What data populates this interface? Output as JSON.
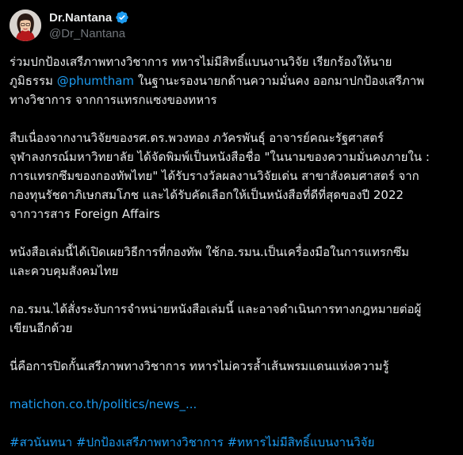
{
  "author": {
    "name": "Dr.Nantana",
    "handle": "@Dr_Nantana"
  },
  "colors": {
    "background": "#000000",
    "text": "#e7e9ea",
    "secondary": "#71767b",
    "link": "#1d9bf0"
  },
  "icons": {
    "verified": "verified-badge-icon"
  },
  "tweet": {
    "p1": {
      "l1": "ร่วมปกป้องเสรีภาพทางวิชาการ ทหารไม่มีสิทธิ์แบนงานวิจัย  เรียกร้องให้นาย",
      "l2_pre": "ภูมิธรรม ",
      "mention": "@phumtham",
      "l2_post": " ในฐานะรองนายกด้านความมั่นคง ออกมาปกป้องเสรีภาพ",
      "l3": "ทางวิชาการ จากการแทรกแซงของทหาร"
    },
    "p2": {
      "l1": "สืบเนื่องจากงานวิจัยของรศ.ดร.พวงทอง ภวัครพันธุ์ อาจารย์คณะรัฐศาสตร์",
      "l2": "จุฬาลงกรณ์มหาวิทยาลัย ได้จัดพิมพ์เป็นหนังสือชื่อ \"ในนามของความมั่นคงภายใน :",
      "l3": "การแทรกซึมของกองทัพไทย\" ได้รับรางวัลผลงานวิจัยเด่น สาขาสังคมศาสตร์ จาก",
      "l4": "กองทุนรัชดาภิเษกสมโภช และได้รับคัดเลือกให้เป็นหนังสือที่ดีที่สุดของปี 2022",
      "l5": "จากวารสาร Foreign Affairs"
    },
    "p3": {
      "l1": "หนังสือเล่มนี้ได้เปิดเผยวิธีการที่กองทัพ ใช้กอ.รมน.เป็นเครื่องมือในการแทรกซึม",
      "l2": "และควบคุมสังคมไทย"
    },
    "p4": {
      "l1": "กอ.รมน.ได้สั่งระงับการจำหน่ายหนังสือเล่มนี้ และอาจดำเนินการทางกฎหมายต่อผู้",
      "l2": "เขียนอีกด้วย"
    },
    "p5": {
      "l1": "นี่คือการปิดกั้นเสรีภาพทางวิชาการ ทหารไม่ควรล้ำเส้นพรมแดนแห่งความรู้"
    },
    "link": "matichon.co.th/politics/news_...",
    "hashtags": [
      "#สวนันทนา",
      "#ปกป้องเสรีภาพทางวิชาการ",
      "#ทหารไม่มีสิทธิ์แบนงานวิจัย"
    ]
  }
}
